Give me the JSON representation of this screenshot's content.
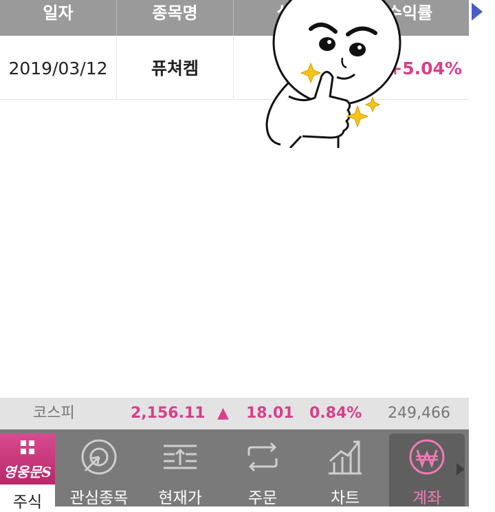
{
  "table": {
    "headers": [
      "일자",
      "종목명",
      "실현",
      "수익률"
    ],
    "row": {
      "date": "2019/03/12",
      "stock": "퓨쳐켐",
      "realized": "",
      "rate": "+5.04%"
    }
  },
  "index_bar": {
    "name": "코스피",
    "value": "2,156.11",
    "direction": "▲",
    "change": "18.01",
    "change_pct": "0.84%",
    "volume": "249,466",
    "up_color": "#d83f8a"
  },
  "nav": {
    "items": [
      {
        "label": "주식",
        "icon": "grid-icon",
        "logo": "영웅문S"
      },
      {
        "label": "관심종목",
        "icon": "target-arrow-icon"
      },
      {
        "label": "현재가",
        "icon": "price-arrows-icon"
      },
      {
        "label": "주문",
        "icon": "swap-arrows-icon"
      },
      {
        "label": "차트",
        "icon": "chart-icon"
      },
      {
        "label": "계좌",
        "icon": "won-icon"
      }
    ],
    "active_index": 5
  },
  "colors": {
    "header_bg": "#9a9a9a",
    "nav_bg": "#7a7a7a",
    "accent": "#d83f8a"
  }
}
